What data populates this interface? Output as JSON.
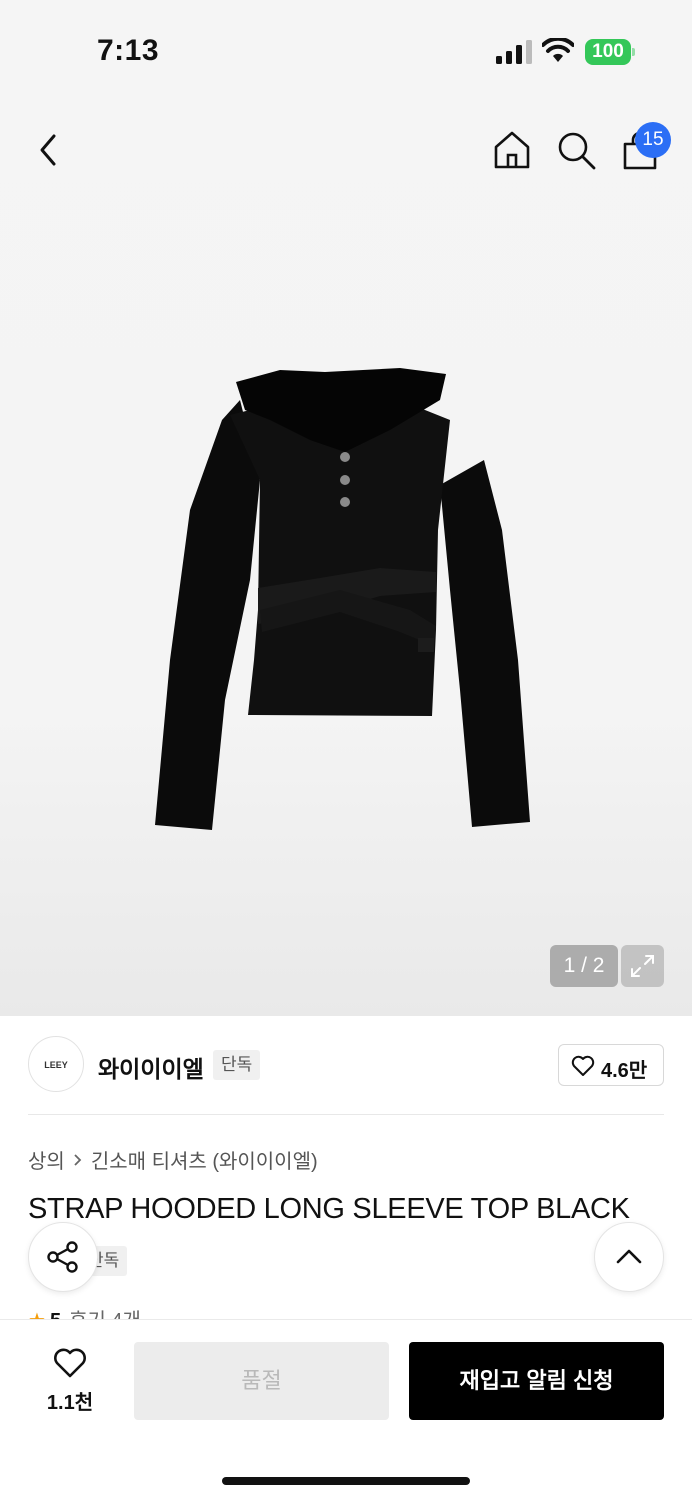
{
  "status": {
    "time": "7:13",
    "battery": "100"
  },
  "header": {
    "cart_count": "15"
  },
  "gallery": {
    "counter": "1 / 2"
  },
  "brand": {
    "logo_text": "LEEY",
    "name": "와이이이엘",
    "tag": "단독",
    "likes": "4.6만"
  },
  "breadcrumb": {
    "category": "상의",
    "subcategory": "긴소매 티셔츠 (와이이이엘)"
  },
  "product": {
    "title": "STRAP HOODED LONG SLEEVE TOP BLACK",
    "tag": "단독"
  },
  "review": {
    "star": "★",
    "score": "5",
    "text": "후기 4개"
  },
  "bottom": {
    "wish_count": "1.1천",
    "soldout_label": "품절",
    "restock_label": "재입고 알림 신청"
  },
  "icons": [
    "chevron-left-icon",
    "home-icon",
    "search-icon",
    "shopping-bag-icon",
    "expand-icon",
    "heart-icon",
    "share-icon",
    "chevron-up-icon"
  ],
  "colors": {
    "badge": "#2b6ef5",
    "battery": "#34c759",
    "primary_button": "#000000",
    "disabled_button": "#ececec",
    "star": "#f59e0b"
  }
}
